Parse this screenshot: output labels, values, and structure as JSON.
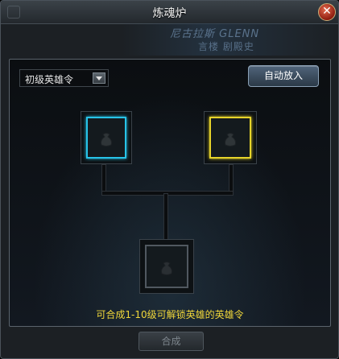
{
  "window": {
    "title": "炼魂炉"
  },
  "banner": {
    "line1": "尼古拉斯 GLENN",
    "line2": "言楼 剧殿史"
  },
  "filter": {
    "selected": "初级英雄令"
  },
  "auto_place_label": "自动放入",
  "slots": [
    {
      "name": "left",
      "color": "#27c3e8"
    },
    {
      "name": "right",
      "color": "#e6d42a"
    },
    {
      "name": "result",
      "color": "#505860"
    }
  ],
  "info_text": "可合成1-10级可解锁英雄的英雄令",
  "combine_label": "合成",
  "icons": {
    "close": "close-icon",
    "dropdown": "chevron-down-icon",
    "slot": "pouch-icon"
  }
}
